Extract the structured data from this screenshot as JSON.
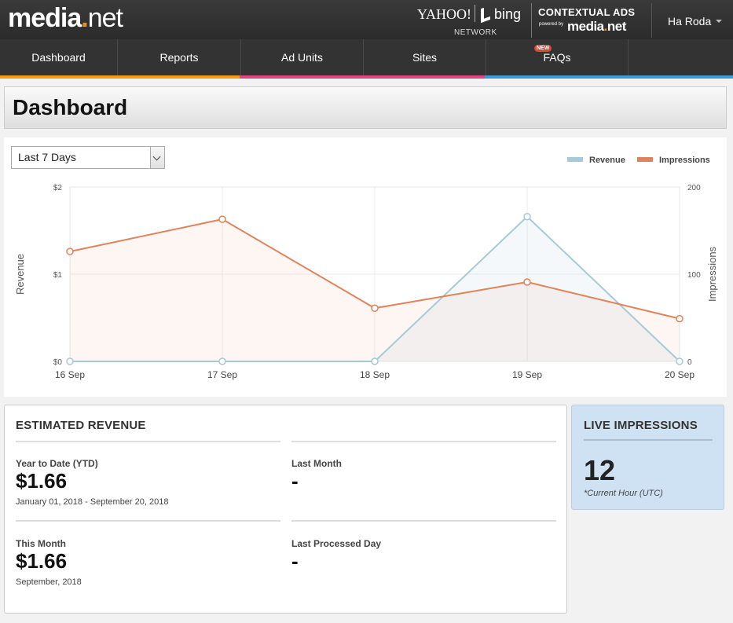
{
  "header": {
    "logo_main": "media",
    "logo_dot": ".",
    "logo_net": "net",
    "yahoo": "YAHOO!",
    "bing": "bing",
    "network": "NETWORK",
    "contextual_ads": "CONTEXTUAL ADS",
    "powered_by": "powered by",
    "powered_logo_main": "media",
    "powered_logo_dot": ".",
    "powered_logo_net": "net",
    "user_name": "Ha Roda"
  },
  "nav": {
    "items": [
      {
        "label": "Dashboard"
      },
      {
        "label": "Reports"
      },
      {
        "label": "Ad Units"
      },
      {
        "label": "Sites"
      },
      {
        "label": "FAQs"
      }
    ],
    "new_badge": "NEW"
  },
  "page": {
    "title": "Dashboard"
  },
  "colors": {
    "revenue": "#a7cad6",
    "impressions": "#e0825a",
    "strip_orange": "#f39c12",
    "strip_pink": "#e0457b",
    "strip_blue": "#3d9ad6"
  },
  "chart_controls": {
    "range_select": "Last 7 Days"
  },
  "chart_data": {
    "type": "line",
    "x": [
      "16 Sep",
      "17 Sep",
      "18 Sep",
      "19 Sep",
      "20 Sep"
    ],
    "series": [
      {
        "name": "Revenue",
        "axis": "left",
        "values": [
          0,
          0,
          0,
          1.66,
          0
        ]
      },
      {
        "name": "Impressions",
        "axis": "right",
        "values": [
          126,
          163,
          61,
          91,
          49
        ]
      }
    ],
    "ylabel": "Revenue",
    "y2label": "Impressions",
    "ylim": [
      0,
      2
    ],
    "y2lim": [
      0,
      200
    ],
    "yticks": [
      "$0",
      "$1",
      "$2"
    ],
    "y2ticks": [
      "0",
      "100",
      "200"
    ],
    "grid": true,
    "area_fill": true,
    "legend": "top-right"
  },
  "revenue_card": {
    "title": "ESTIMATED REVENUE",
    "ytd_label": "Year to Date (YTD)",
    "ytd_value": "$1.66",
    "ytd_range": "January 01, 2018 - September 20, 2018",
    "last_month_label": "Last Month",
    "last_month_value": "-",
    "this_month_label": "This Month",
    "this_month_value": "$1.66",
    "this_month_sub": "September, 2018",
    "last_processed_label": "Last Processed Day",
    "last_processed_value": "-"
  },
  "live_card": {
    "title": "LIVE IMPRESSIONS",
    "value": "12",
    "note": "*Current Hour (UTC)"
  }
}
